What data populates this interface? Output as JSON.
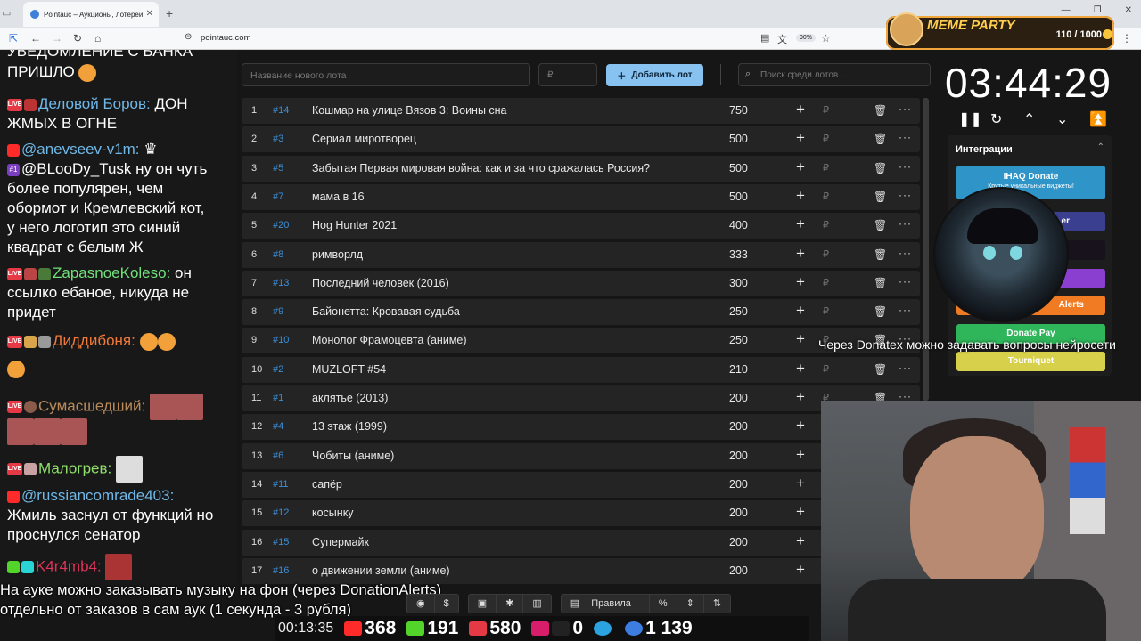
{
  "browser": {
    "tab_title": "Pointauc – Аукционы, лотереи",
    "url": "pointauc.com",
    "zoom": "90%"
  },
  "meme_party": {
    "title": "MEME PARTY",
    "count": "110 / 1000"
  },
  "chat": {
    "lines": [
      "УВЕДОМЛЕНИЕ С БАНКА",
      "ПРИШЛО",
      "Деловой Боров:",
      " ДОН",
      "ЖМЫХ В ОГНЕ",
      "@anevseev-v1m:",
      "@BLooDy_Tusk ну он чуть",
      "более популярен, чем",
      "обормот и Кремлевский кот,",
      "у него логотип это синий",
      "квадрат с белым Ж",
      "ZapasnoeKoleso:",
      " он",
      "ссылко ебаное, никуда не",
      "придет",
      "Диддибоня:",
      "Сумасшедший:",
      "Малогрев:",
      "@russiancomrade403:",
      "Жмиль заснул от функций но",
      "проснулся сенатор",
      "K4r4mb4:"
    ],
    "badge_live": "LIVE",
    "badge_sub": "#1"
  },
  "toolbar": {
    "lot_placeholder": "Название нового лота",
    "cost_placeholder": "₽",
    "add_label": "Добавить лот",
    "search_placeholder": "Поиск среди лотов..."
  },
  "lots": [
    {
      "n": "1",
      "id": "#14",
      "name": "Кошмар на улице Вязов 3: Воины сна",
      "value": "750"
    },
    {
      "n": "2",
      "id": "#3",
      "name": "Сериал миротворец",
      "value": "500"
    },
    {
      "n": "3",
      "id": "#5",
      "name": "Забытая Первая мировая война: как и за что сражалась Россия?",
      "value": "500"
    },
    {
      "n": "4",
      "id": "#7",
      "name": "мама в 16",
      "value": "500"
    },
    {
      "n": "5",
      "id": "#20",
      "name": "Hog Hunter 2021",
      "value": "400"
    },
    {
      "n": "6",
      "id": "#8",
      "name": "римворлд",
      "value": "333"
    },
    {
      "n": "7",
      "id": "#13",
      "name": "Последний человек (2016)",
      "value": "300"
    },
    {
      "n": "8",
      "id": "#9",
      "name": "Байонетта: Кровавая судьба",
      "value": "250"
    },
    {
      "n": "9",
      "id": "#10",
      "name": "Монолог Фрамоцевта (аниме)",
      "value": "250"
    },
    {
      "n": "10",
      "id": "#2",
      "name": "MUZLOFT #54",
      "value": "210"
    },
    {
      "n": "11",
      "id": "#1",
      "name": "аклятье (2013)",
      "value": "200"
    },
    {
      "n": "12",
      "id": "#4",
      "name": "13 этаж (1999)",
      "value": "200"
    },
    {
      "n": "13",
      "id": "#6",
      "name": "Чобиты (аниме)",
      "value": "200"
    },
    {
      "n": "14",
      "id": "#11",
      "name": "сапёр",
      "value": "200"
    },
    {
      "n": "15",
      "id": "#12",
      "name": "косынку",
      "value": "200"
    },
    {
      "n": "16",
      "id": "#15",
      "name": "Супермайк",
      "value": "200"
    },
    {
      "n": "17",
      "id": "#16",
      "name": "о движении земли (аниме)",
      "value": "200"
    }
  ],
  "lot_icons": {
    "plus": "+",
    "rub": "₽",
    "trash": "🗑",
    "more": "···"
  },
  "timer": {
    "value": "03:44:29"
  },
  "integrations": {
    "title": "Интеграции",
    "items": [
      {
        "label": "IHAQ Donate",
        "sub": "Крутые уникальные виджеты!",
        "color": "#2f95c8"
      },
      {
        "label": "er",
        "sub": "",
        "color": "#3b3f8f"
      },
      {
        "label": "",
        "sub": "",
        "color": "#17121c"
      },
      {
        "label": "",
        "sub": "",
        "color": "#8a3fd1"
      },
      {
        "label": "Alerts",
        "sub": "",
        "color": "#f07b22"
      },
      {
        "label": "Donate Pay",
        "sub": "",
        "color": "#2fb55a"
      },
      {
        "label": "Tourniquet",
        "sub": "",
        "color": "#d6d04a"
      }
    ]
  },
  "overlay": {
    "donatex": "Через Donatex можно задавать вопросы нейросети",
    "subs_line1": "На ауке можно заказывать музыку на фон (через DonationAlerts)",
    "subs_line2": "отдельно от заказов в сам аук (1 секунда - 3 рубля)"
  },
  "bottom_toolbar": {
    "rules": "Правила"
  },
  "stream_stats": {
    "uptime": "00:13:35",
    "youtube": "368",
    "kick": "191",
    "live": "580",
    "rutube": "0",
    "telegram": "",
    "viewers": "1 139"
  },
  "colors": {
    "accent": "#87c2f0",
    "id_blue": "#3c8ed6",
    "row_bg": "#242424"
  }
}
